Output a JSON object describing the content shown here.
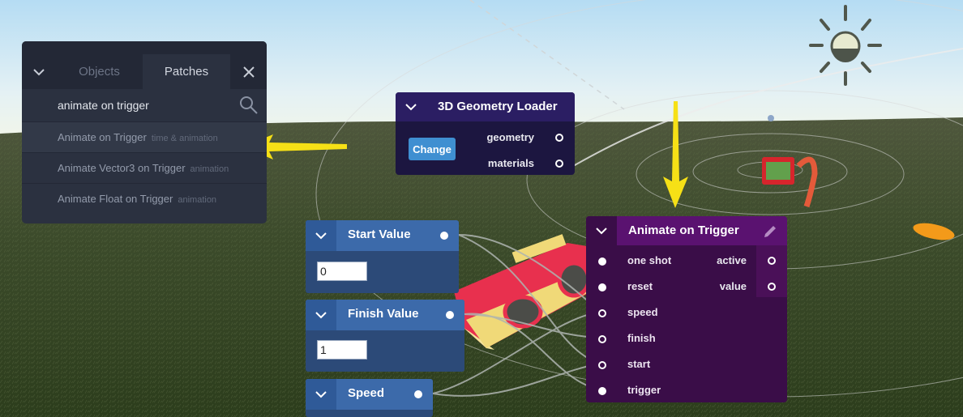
{
  "search_panel": {
    "tabs": [
      "Objects",
      "Patches"
    ],
    "search_value": "animate on trigger",
    "results": [
      {
        "name": "Animate on Trigger",
        "category": "time & animation"
      },
      {
        "name": "Animate Vector3 on Trigger",
        "category": "animation"
      },
      {
        "name": "Animate Float on Trigger",
        "category": "animation"
      }
    ]
  },
  "geometry_node": {
    "title": "3D Geometry Loader",
    "button": "Change",
    "outputs": [
      "geometry",
      "materials"
    ]
  },
  "start_node": {
    "title": "Start Value",
    "value": "0"
  },
  "finish_node": {
    "title": "Finish Value",
    "value": "1"
  },
  "speed_node": {
    "title": "Speed"
  },
  "animate_node": {
    "title": "Animate on Trigger",
    "inputs": [
      "one shot",
      "reset",
      "speed",
      "finish",
      "start",
      "trigger"
    ],
    "outputs": [
      "active",
      "value"
    ]
  },
  "colors": {
    "accent_blue": "#3f8fd1",
    "patch_purple": "#5a1270",
    "value_node_blue": "#3c6aaa",
    "arrow_yellow": "#f6e016"
  },
  "icons": [
    "chevron-down-icon",
    "close-icon",
    "search-icon",
    "pencil-icon",
    "sun-icon",
    "arrow-annotation"
  ]
}
